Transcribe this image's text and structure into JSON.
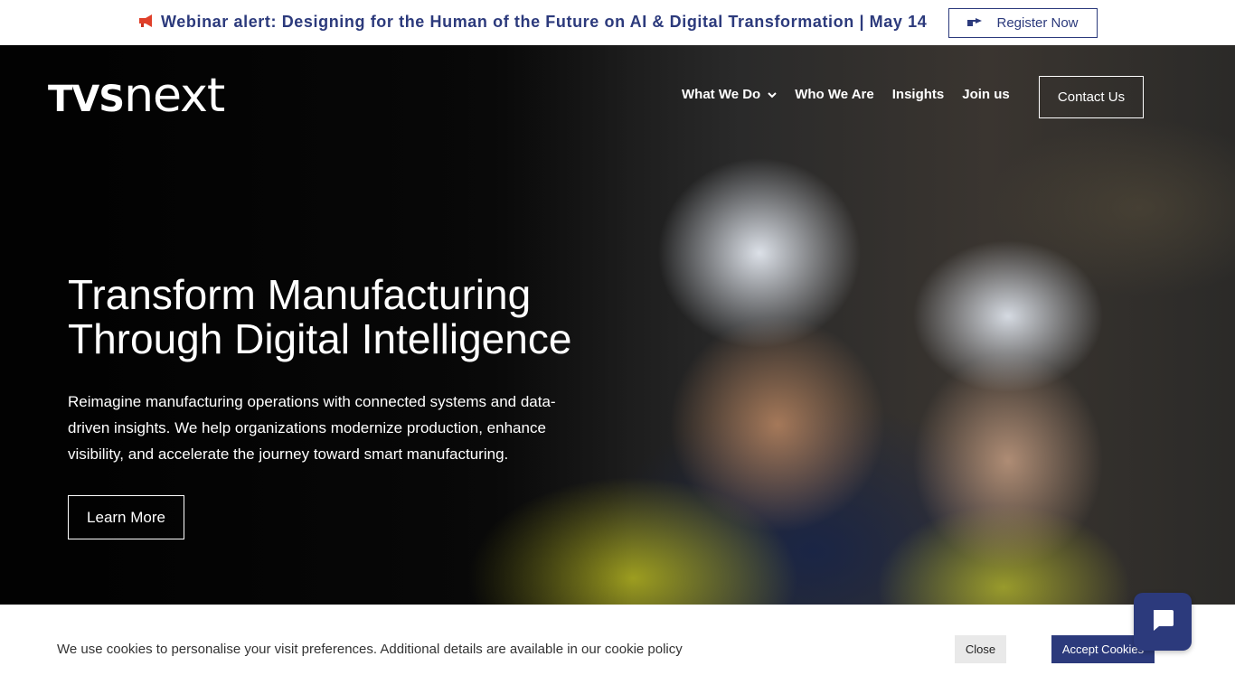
{
  "announcement": {
    "icon": "megaphone-icon",
    "text": "Webinar alert: Designing for the Human of the Future on AI & Digital Transformation | May 14",
    "button_icon": "hand-pointing-icon",
    "button_label": "Register Now"
  },
  "header": {
    "logo_text_tvs": "TVS",
    "logo_text_next": "next",
    "nav": [
      {
        "label": "What We Do",
        "has_dropdown": true
      },
      {
        "label": "Who We Are"
      },
      {
        "label": "Insights"
      },
      {
        "label": "Join us"
      }
    ],
    "contact_label": "Contact Us"
  },
  "hero": {
    "title": "Transform Manufacturing Through Digital Intelligence",
    "description": "Reimagine manufacturing operations with connected systems and data-driven insights. We help organizations modernize production, enhance visibility, and accelerate the journey toward smart manufacturing.",
    "cta_label": "Learn More"
  },
  "cookie_banner": {
    "text": "We use cookies to personalise your visit preferences. Additional details are available in our cookie policy",
    "close_label": "Close",
    "accept_label": "Accept Cookies"
  },
  "chat": {
    "icon": "chat-bubble-icon"
  },
  "colors": {
    "brand": "#2c3a7c",
    "white": "#ffffff"
  }
}
